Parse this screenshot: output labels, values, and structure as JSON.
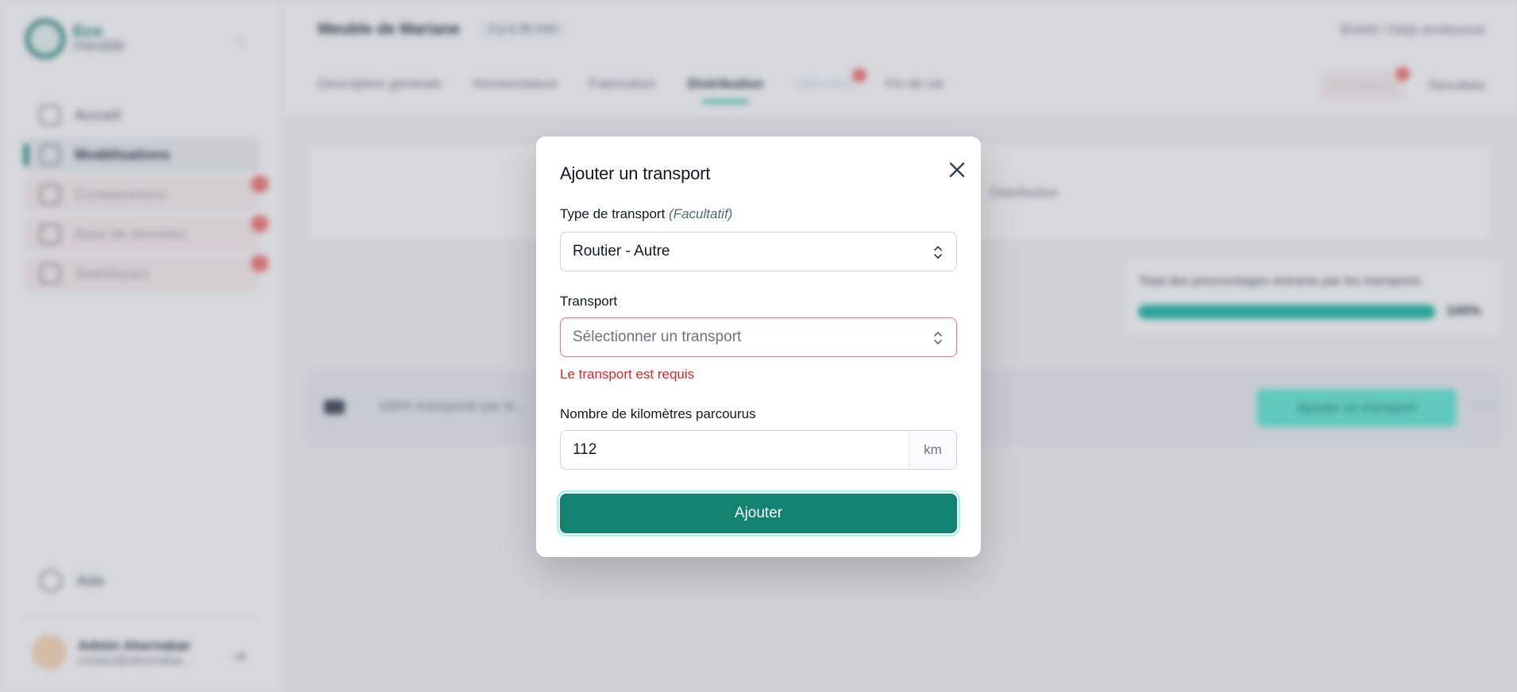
{
  "background": {
    "logo": {
      "line1": "Eco",
      "line2": "meuble"
    },
    "sidebar": {
      "items": [
        {
          "label": "Accueil",
          "icon": "home-icon"
        },
        {
          "label": "Modélisations",
          "icon": "grid-icon",
          "active": true
        },
        {
          "label": "Comparaisons",
          "icon": "compare-icon",
          "locked": true
        },
        {
          "label": "Base de données",
          "icon": "database-icon",
          "locked": true
        },
        {
          "label": "Statistiques",
          "icon": "chart-icon",
          "locked": true
        }
      ],
      "help_label": "Aide",
      "user": {
        "name": "Admin Ahernabar",
        "email": "contact@ahernabar..."
      }
    },
    "header": {
      "product_name": "Meuble de Mariane",
      "product_meta": "il y a 3h min",
      "top_right": "BVAM  /  Déjà remboursé",
      "tabs": [
        {
          "label": "Description générale"
        },
        {
          "label": "Nomenclature"
        },
        {
          "label": "Fabrication"
        },
        {
          "label": "Distribution",
          "active": true
        },
        {
          "label": "Utilisation",
          "locked": true
        },
        {
          "label": "Fin de vie"
        }
      ],
      "simulation_label": "Simulation",
      "results_label": "Résultats"
    },
    "info_text": "Distribution",
    "total": {
      "label": "Total des pourcentages entrants par les transports",
      "percent_text": "100%",
      "fraction": 1.0
    },
    "row": {
      "text": "100% transporté par le...",
      "add_button": "Ajouter un transport"
    }
  },
  "modal": {
    "title": "Ajouter un transport",
    "type_label": "Type de transport",
    "type_optional": "(Facultatif)",
    "type_value": "Routier - Autre",
    "transport_label": "Transport",
    "transport_placeholder": "Sélectionner un transport",
    "transport_error": "Le transport est requis",
    "km_label": "Nombre de kilomètres parcourus",
    "km_value": "112",
    "km_unit": "km",
    "submit_label": "Ajouter"
  },
  "colors": {
    "accent": "#11836f",
    "error": "#dc2626",
    "teal_light": "#14b8a6"
  }
}
